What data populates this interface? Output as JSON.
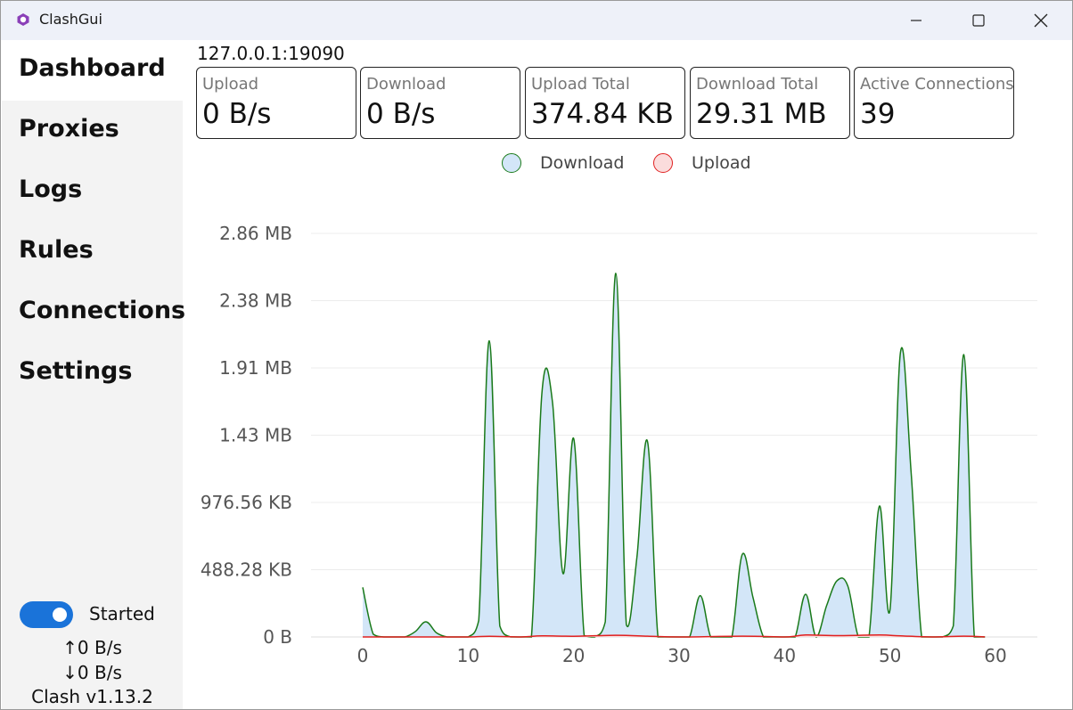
{
  "app": {
    "title": "ClashGui"
  },
  "sidebar": {
    "items": [
      {
        "label": "Dashboard",
        "active": true
      },
      {
        "label": "Proxies",
        "active": false
      },
      {
        "label": "Logs",
        "active": false
      },
      {
        "label": "Rules",
        "active": false
      },
      {
        "label": "Connections",
        "active": false
      },
      {
        "label": "Settings",
        "active": false
      }
    ],
    "toggle": {
      "label": "Started",
      "on": true
    },
    "upload_speed": "↑0 B/s",
    "download_speed": "↓0 B/s",
    "version": "Clash v1.13.2"
  },
  "main": {
    "address": "127.0.0.1:19090",
    "stats": [
      {
        "label": "Upload",
        "value": "0 B/s"
      },
      {
        "label": "Download",
        "value": "0 B/s"
      },
      {
        "label": "Upload Total",
        "value": "374.84 KB"
      },
      {
        "label": "Download Total",
        "value": "29.31 MB"
      },
      {
        "label": "Active Connections",
        "value": "39"
      }
    ]
  },
  "colors": {
    "accent": "#1a73d9",
    "download_line": "#1a7a1a",
    "download_fill": "#d3e6f8",
    "upload_line": "#e02020",
    "upload_fill": "#fbdcdc"
  },
  "chart_data": {
    "type": "area",
    "legend": [
      "Download",
      "Upload"
    ],
    "legend_position": "top",
    "y_tick_labels": [
      "0 B",
      "488.28 KB",
      "976.56 KB",
      "1.43 MB",
      "1.91 MB",
      "2.38 MB",
      "2.86 MB"
    ],
    "x_ticks": [
      0,
      10,
      20,
      30,
      40,
      50,
      60
    ],
    "xlim": [
      0,
      60
    ],
    "ylim_kb": [
      0,
      2929.69
    ],
    "grid": true,
    "series": [
      {
        "name": "Download",
        "unit": "KB",
        "points": [
          [
            0,
            360
          ],
          [
            1,
            20
          ],
          [
            2,
            0
          ],
          [
            3,
            0
          ],
          [
            4,
            0
          ],
          [
            5,
            40
          ],
          [
            6,
            110
          ],
          [
            7,
            30
          ],
          [
            8,
            0
          ],
          [
            9,
            0
          ],
          [
            10,
            0
          ],
          [
            11,
            120
          ],
          [
            12,
            2150
          ],
          [
            13,
            80
          ],
          [
            14,
            0
          ],
          [
            15,
            0
          ],
          [
            16,
            0
          ],
          [
            17,
            1780
          ],
          [
            18,
            1700
          ],
          [
            19,
            460
          ],
          [
            20,
            1440
          ],
          [
            21,
            10
          ],
          [
            22,
            0
          ],
          [
            23,
            110
          ],
          [
            24,
            2640
          ],
          [
            25,
            90
          ],
          [
            26,
            580
          ],
          [
            27,
            1420
          ],
          [
            28,
            0
          ],
          [
            29,
            0
          ],
          [
            30,
            0
          ],
          [
            31,
            0
          ],
          [
            32,
            300
          ],
          [
            33,
            0
          ],
          [
            34,
            0
          ],
          [
            35,
            0
          ],
          [
            36,
            600
          ],
          [
            37,
            290
          ],
          [
            38,
            0
          ],
          [
            39,
            0
          ],
          [
            40,
            0
          ],
          [
            41,
            0
          ],
          [
            42,
            310
          ],
          [
            43,
            0
          ],
          [
            44,
            230
          ],
          [
            45,
            410
          ],
          [
            46,
            370
          ],
          [
            47,
            0
          ],
          [
            48,
            0
          ],
          [
            49,
            950
          ],
          [
            50,
            200
          ],
          [
            51,
            2070
          ],
          [
            52,
            1200
          ],
          [
            53,
            0
          ],
          [
            54,
            0
          ],
          [
            55,
            0
          ],
          [
            56,
            80
          ],
          [
            57,
            2050
          ],
          [
            58,
            0
          ],
          [
            59,
            0
          ]
        ]
      },
      {
        "name": "Upload",
        "unit": "KB",
        "points": [
          [
            0,
            0
          ],
          [
            5,
            0
          ],
          [
            10,
            0
          ],
          [
            12,
            5
          ],
          [
            15,
            0
          ],
          [
            17,
            8
          ],
          [
            20,
            5
          ],
          [
            24,
            12
          ],
          [
            27,
            6
          ],
          [
            30,
            0
          ],
          [
            36,
            6
          ],
          [
            40,
            0
          ],
          [
            42,
            14
          ],
          [
            45,
            10
          ],
          [
            49,
            14
          ],
          [
            51,
            8
          ],
          [
            54,
            0
          ],
          [
            57,
            6
          ],
          [
            59,
            0
          ]
        ]
      }
    ]
  }
}
